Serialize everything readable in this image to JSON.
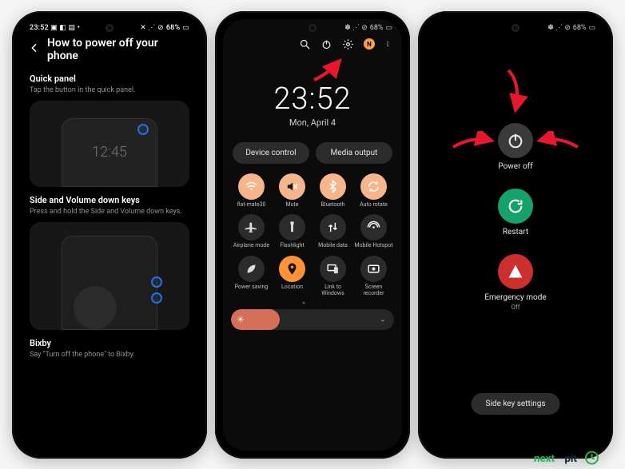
{
  "phone1": {
    "status": {
      "time": "23:52",
      "left_icons": "▣ ◧ ▤ •",
      "right_icons": "✕ ⋰ ⊘",
      "battery": "68%"
    },
    "back_icon": "arrow-left-icon",
    "title": "How to power off your phone",
    "sections": [
      {
        "heading": "Quick panel",
        "sub": "Tap the button in the quick panel.",
        "mock_time": "12:45"
      },
      {
        "heading": "Side and Volume down keys",
        "sub": "Press and hold the Side and Volume down keys."
      },
      {
        "heading": "Bixby",
        "sub": "Say \"Turn off the phone\" to Bixby."
      }
    ]
  },
  "phone2": {
    "status": {
      "right_icons": "✽ ⋰ ⊘",
      "battery": "68%"
    },
    "header_icons": [
      "search-icon",
      "power-icon",
      "gear-icon"
    ],
    "notif_badge": "N",
    "clock": {
      "time": "23:52",
      "date": "Mon, April 4"
    },
    "pills": [
      "Device control",
      "Media output"
    ],
    "tiles": [
      {
        "label": "flat-mate30",
        "icon": "wifi",
        "state": "on"
      },
      {
        "label": "Mute",
        "icon": "mute",
        "state": "on"
      },
      {
        "label": "Bluetooth",
        "icon": "bt",
        "state": "on"
      },
      {
        "label": "Auto rotate",
        "icon": "rotate",
        "state": "on"
      },
      {
        "label": "Airplane mode",
        "icon": "plane",
        "state": "off"
      },
      {
        "label": "Flashlight",
        "icon": "flash",
        "state": "off"
      },
      {
        "label": "Mobile data",
        "icon": "data",
        "state": "off"
      },
      {
        "label": "Mobile Hotspot",
        "icon": "hotspot",
        "state": "off"
      },
      {
        "label": "Power saving",
        "icon": "leaf",
        "state": "off"
      },
      {
        "label": "Location",
        "icon": "pin",
        "state": "loc"
      },
      {
        "label": "Link to Windows",
        "icon": "link",
        "state": "off"
      },
      {
        "label": "Screen recorder",
        "icon": "rec",
        "state": "off"
      }
    ],
    "brightness_percent": 30
  },
  "phone3": {
    "status": {
      "right_icons": "✽ ⋰ ⊘",
      "battery": "68%"
    },
    "items": [
      {
        "label": "Power off",
        "sub": "",
        "color": "grey",
        "icon": "power-icon"
      },
      {
        "label": "Restart",
        "sub": "",
        "color": "green",
        "icon": "restart-icon"
      },
      {
        "label": "Emergency mode",
        "sub": "Off",
        "color": "red",
        "icon": "alert-icon"
      }
    ],
    "side_key_btn": "Side key settings"
  },
  "watermark": "nextpit"
}
